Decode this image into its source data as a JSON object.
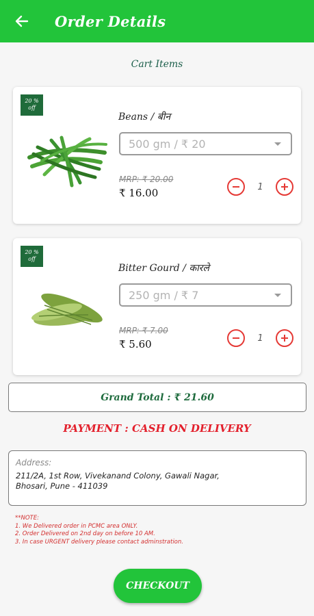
{
  "header": {
    "title": "Order Details",
    "back_icon": "arrow-left-icon"
  },
  "cart": {
    "section_title": "Cart Items",
    "items": [
      {
        "discount_badge": "20 % off",
        "name": "Beans / बीन",
        "variant": "500 gm / ₹ 20",
        "mrp": "MRP: ₹ 20.00",
        "price": "₹ 16.00",
        "quantity": "1"
      },
      {
        "discount_badge": "20 % off",
        "name": "Bitter Gourd / कारले",
        "variant": "250 gm / ₹ 7",
        "mrp": "MRP: ₹ 7.00",
        "price": "₹ 5.60",
        "quantity": "1"
      }
    ]
  },
  "grand_total": "Grand Total : ₹ 21.60",
  "payment": "PAYMENT : CASH ON DELIVERY",
  "address": {
    "label": "Address:",
    "line1": "211/2A, 1st Row, Vivekanand Colony, Gawali Nagar,",
    "line2": "Bhosari, Pune - 411039"
  },
  "note": {
    "heading": "**NOTE:",
    "lines": [
      "1. We Delivered order in PCMC area ONLY.",
      "2. Order Delivered on 2nd day on before 10 AM.",
      "3. In case URGENT delivery please contact adminstration."
    ]
  },
  "checkout_label": "CHECKOUT",
  "colors": {
    "primary": "#22c43a",
    "badge": "#1f6b3a",
    "accent_red": "#e53935",
    "total_text": "#1e6b3d"
  }
}
